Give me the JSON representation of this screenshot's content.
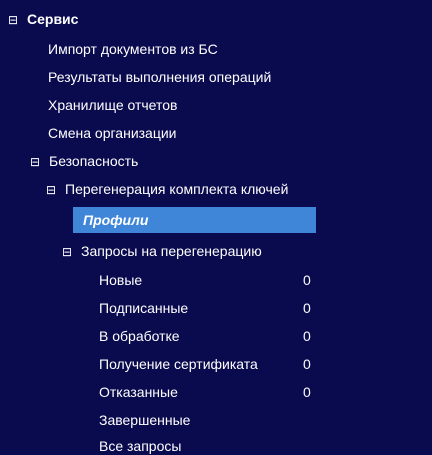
{
  "tree": {
    "root": {
      "toggle": "⊟",
      "label": "Сервис"
    },
    "service_items": [
      "Импорт документов из БС",
      "Результаты выполнения операций",
      "Хранилище отчетов",
      "Смена организации"
    ],
    "security": {
      "toggle": "⊟",
      "label": "Безопасность"
    },
    "regen": {
      "toggle": "⊟",
      "label": "Перегенерация комплекта ключей"
    },
    "profiles": {
      "label": "Профили"
    },
    "requests": {
      "toggle": "⊟",
      "label": "Запросы на перегенерацию"
    },
    "request_items": [
      {
        "label": "Новые",
        "count": "0"
      },
      {
        "label": "Подписанные",
        "count": "0"
      },
      {
        "label": "В обработке",
        "count": "0"
      },
      {
        "label": "Получение сертификата",
        "count": "0"
      },
      {
        "label": "Отказанные",
        "count": "0"
      },
      {
        "label": "Завершенные",
        "count": ""
      },
      {
        "label": "Все запросы",
        "count": ""
      }
    ]
  },
  "colors": {
    "background": "#0a0a4e",
    "selected": "#3f86d9",
    "text": "#ffffff"
  }
}
